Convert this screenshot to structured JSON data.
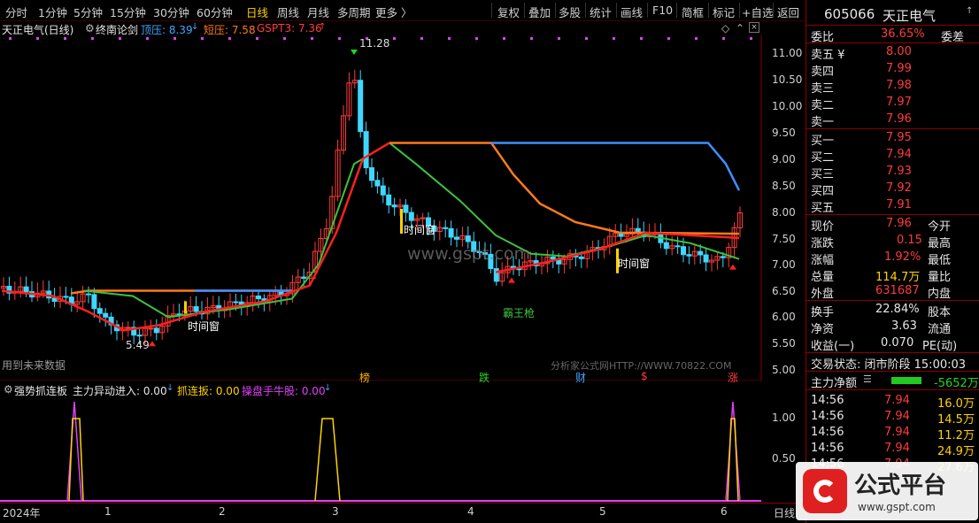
{
  "toolbar": {
    "periods": [
      "分时",
      "1分钟",
      "5分钟",
      "15分钟",
      "30分钟",
      "60分钟",
      "日线",
      "周线",
      "月线",
      "多周期",
      "更多 〉"
    ],
    "active_period": "日线",
    "actions": [
      "复权",
      "叠加",
      "多股",
      "统计",
      "画线",
      "F10",
      "简框",
      "标记",
      "+自选",
      "返回"
    ]
  },
  "chart": {
    "title": "天正电气(日线)",
    "indicator": "终南论剑",
    "top_label": "顶压: 8.39",
    "short_label": "短压: 7.58",
    "gspt_label": "GSPT3: 7.36",
    "high_marker": "11.28",
    "low_marker": "5.49",
    "y_ticks": [
      "11.00",
      "10.50",
      "10.00",
      "9.50",
      "9.00",
      "8.50",
      "8.00",
      "7.50",
      "7.00",
      "6.50",
      "6.00",
      "5.50",
      "5.00"
    ],
    "annotations": {
      "time_window": "时间窗",
      "bawang": "霸王枪",
      "future_data": "用到未来数据",
      "watermark": "www.gspt.com",
      "source": "分析家公式网HTTP://WWW.70822.COM"
    },
    "events": [
      "榜",
      "跌",
      "财",
      "$",
      "涨"
    ],
    "colors": {
      "up": "#ff3b3b",
      "down": "#3fd7ff",
      "ma_red": "#ff2020",
      "ma_green": "#3cc43c",
      "ma_orange": "#ff7a1a",
      "ma_blue": "#3f8fff"
    }
  },
  "sub_chart": {
    "name": "强势抓连板",
    "main_label": "主力异动进入: 0.00",
    "catch_label": "抓连扳: 0.00",
    "bull_label": "操盘手牛股: 0.00",
    "y_ticks": [
      "1.00",
      "0.50"
    ]
  },
  "x_axis": {
    "labels": [
      "2024年",
      "1",
      "2",
      "3",
      "4",
      "5",
      "6"
    ],
    "period": "日线"
  },
  "right_panel": {
    "code": "605066",
    "name": "天正电气",
    "wei_bi_label": "委比",
    "wei_bi": "36.65%",
    "wei_cha_label": "委差",
    "sell": [
      {
        "label": "卖五 ¥",
        "price": "8.00"
      },
      {
        "label": "卖四",
        "price": "7.99"
      },
      {
        "label": "卖三",
        "price": "7.98"
      },
      {
        "label": "卖二",
        "price": "7.97"
      },
      {
        "label": "卖一",
        "price": "7.96"
      }
    ],
    "buy": [
      {
        "label": "买一",
        "price": "7.95"
      },
      {
        "label": "买二",
        "price": "7.94"
      },
      {
        "label": "买三",
        "price": "7.93"
      },
      {
        "label": "买四",
        "price": "7.92"
      },
      {
        "label": "买五",
        "price": "7.91"
      }
    ],
    "stats": [
      {
        "label": "现价",
        "value": "7.96",
        "label2": "今开"
      },
      {
        "label": "涨跌",
        "value": "0.15",
        "label2": "最高"
      },
      {
        "label": "涨幅",
        "value": "1.92%",
        "label2": "最低"
      },
      {
        "label": "总量",
        "value": "114.7万",
        "label2": "量比"
      },
      {
        "label": "外盘",
        "value": "631687",
        "label2": "内盘"
      }
    ],
    "stats2": [
      {
        "label": "换手",
        "value": "22.84%",
        "label2": "股本"
      },
      {
        "label": "净资",
        "value": "3.63",
        "label2": "流通"
      },
      {
        "label": "收益(一)",
        "value": "0.070",
        "label2": "PE(动)"
      }
    ],
    "status": "交易状态: 闭市阶段 15:00:03",
    "net_flow_label": "主力净额",
    "net_flow_value": "-5652万",
    "ticks": [
      {
        "time": "14:56",
        "price": "7.94",
        "vol": "16.0万"
      },
      {
        "time": "14:56",
        "price": "7.94",
        "vol": "14.5万"
      },
      {
        "time": "14:56",
        "price": "7.94",
        "vol": "11.2万"
      },
      {
        "time": "14:56",
        "price": "7.94",
        "vol": "24.9万"
      },
      {
        "time": "14:56",
        "price": "7.94",
        "vol": "27.6万"
      }
    ],
    "logo_text": "公式平台",
    "logo_url": "www.gspt.com"
  }
}
